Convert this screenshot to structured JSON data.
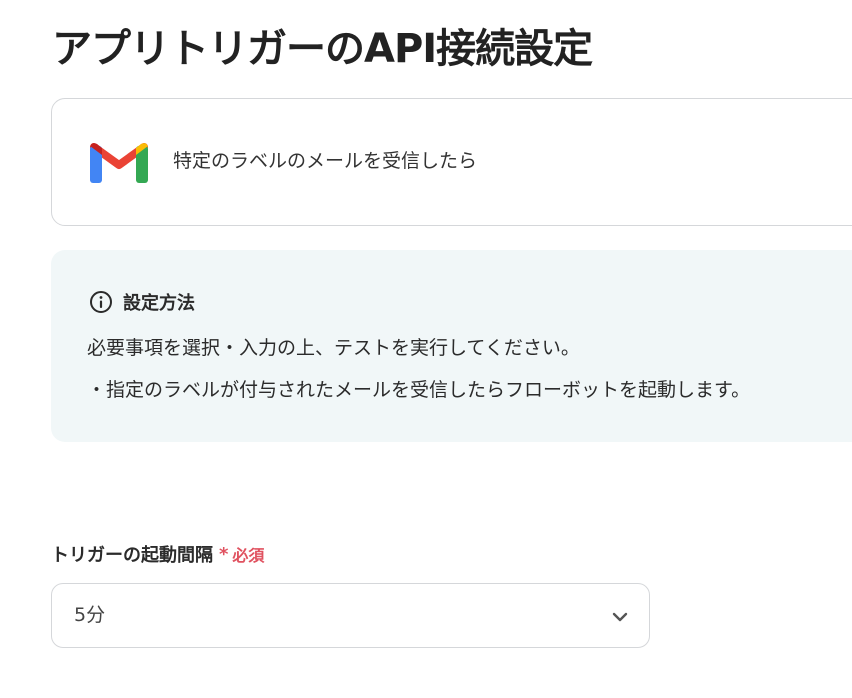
{
  "page": {
    "title": "アプリトリガーのAPI接続設定"
  },
  "app_card": {
    "app_icon": "gmail-icon",
    "trigger_name": "特定のラベルのメールを受信したら"
  },
  "info_box": {
    "icon": "info-circle-icon",
    "title": "設定方法",
    "lines": [
      "必要事項を選択・入力の上、テストを実行してください。",
      "・指定のラベルが付与されたメールを受信したらフローボットを起動します。"
    ]
  },
  "interval_field": {
    "label": "トリガーの起動間隔",
    "required_mark": "*",
    "required_text": "必須",
    "selected_value": "5分",
    "dropdown_icon": "chevron-down-icon"
  },
  "colors": {
    "required": "#e05260",
    "info_background": "#f1f7f8",
    "border": "#d5d7da",
    "gmail_red": "#ea4335",
    "gmail_blue": "#4285f4",
    "gmail_green": "#34a853",
    "gmail_yellow": "#fbbc04"
  }
}
